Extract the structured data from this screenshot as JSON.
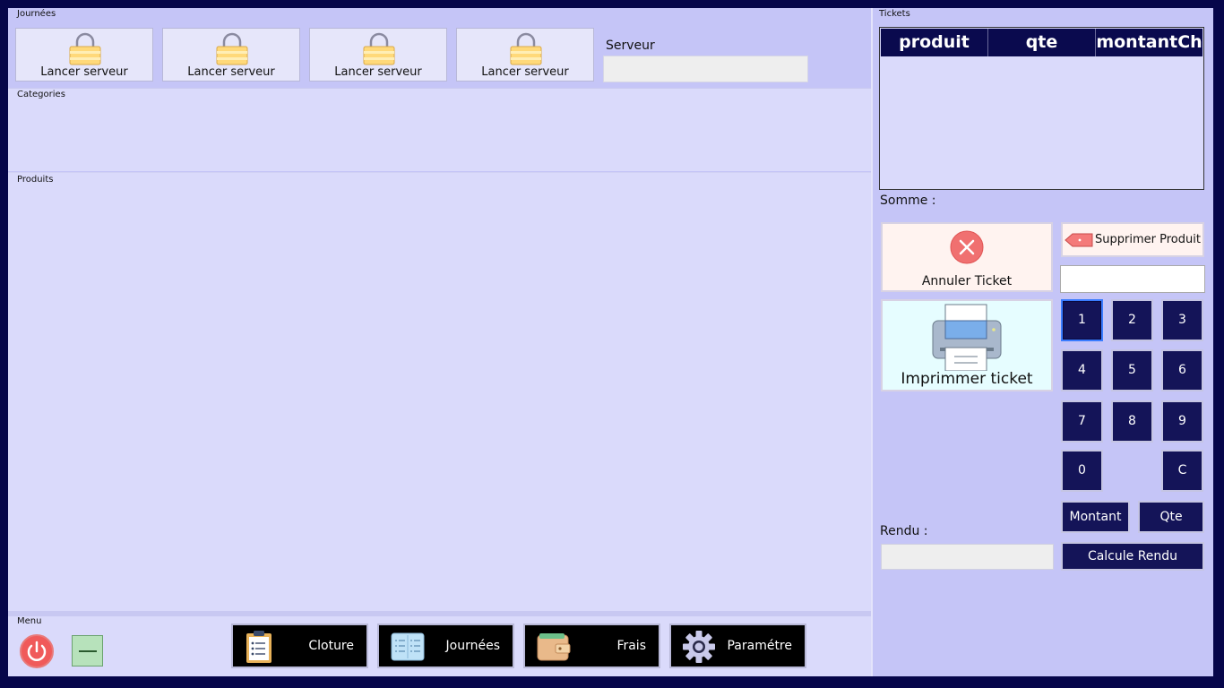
{
  "journees": {
    "title": "Journées",
    "buttons": [
      {
        "label": "Lancer serveur"
      },
      {
        "label": "Lancer serveur"
      },
      {
        "label": "Lancer serveur"
      },
      {
        "label": "Lancer serveur"
      }
    ],
    "serveur_label": "Serveur",
    "serveur_value": ""
  },
  "categories": {
    "title": "Categories"
  },
  "produits": {
    "title": "Produits"
  },
  "menu": {
    "title": "Menu",
    "buttons": [
      {
        "label": "Cloture",
        "icon": "clipboard-icon"
      },
      {
        "label": "Journées",
        "icon": "list-icon"
      },
      {
        "label": "Frais",
        "icon": "wallet-icon"
      },
      {
        "label": "Paramétre",
        "icon": "gear-icon"
      }
    ]
  },
  "tickets": {
    "title": "Tickets",
    "columns": [
      "produit",
      "qte",
      "montantCh"
    ],
    "rows": []
  },
  "somme_label": "Somme :",
  "annuler_label": "Annuler Ticket",
  "supprimer_label": "Supprimer Produit",
  "supprimer_input_value": "",
  "imprimer_label": "Imprimmer ticket",
  "keypad": [
    "1",
    "2",
    "3",
    "4",
    "5",
    "6",
    "7",
    "8",
    "9",
    "0",
    "C"
  ],
  "montant_label": "Montant",
  "qte_label": "Qte",
  "rendu_label": "Rendu :",
  "rendu_value": "",
  "calcule_rendu_label": "Calcule Rendu",
  "colors": {
    "background": "#06064a",
    "panel": "#c5c5f7",
    "content": "#dadafb",
    "button_dark": "#141458",
    "danger": "#f05a5a"
  }
}
